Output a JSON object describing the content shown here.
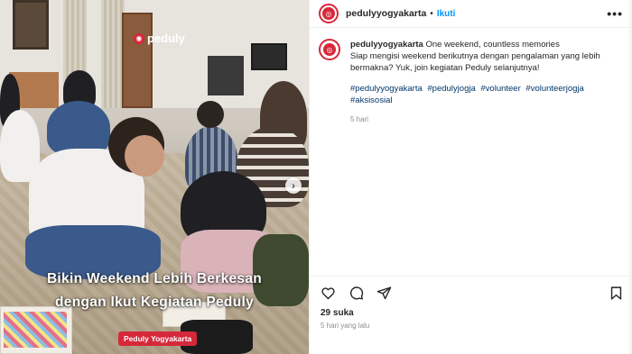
{
  "post_image": {
    "brand_logo_text": "peduly",
    "overlay_line1": "Bikin Weekend Lebih Berkesan",
    "overlay_line2": "dengan Ikut Kegiatan Peduly",
    "tag_label": "Peduly Yogyakarta",
    "next_icon": "chevron-right-icon"
  },
  "header": {
    "username": "pedulyyogyakarta",
    "separator": "•",
    "follow_label": "Ikuti",
    "more_icon": "more-horizontal-icon",
    "more_glyph": "•••"
  },
  "caption": {
    "username": "pedulyyogyakarta",
    "first_line": "One weekend, countless memories",
    "line2": "Siap mengisi weekend berikutnya dengan pengalaman yang lebih",
    "line3": "bermakna? Yuk, join kegiatan Peduly selanjutnya!",
    "hashtags": [
      "#pedulyyogyakarta",
      "#pedulyjogja",
      "#volunteer",
      "#volunteerjogja",
      "#aksisosial"
    ],
    "time": "5 hari"
  },
  "actions": {
    "like_icon": "heart-icon",
    "comment_icon": "comment-icon",
    "share_icon": "share-icon",
    "save_icon": "bookmark-icon",
    "likes": "29 suka",
    "posted_ago": "5 hari yang lalu"
  },
  "colors": {
    "brand_red": "#d6283a",
    "link_blue": "#0095f6",
    "hashtag_blue": "#00376b",
    "muted": "#8e8e8e"
  }
}
